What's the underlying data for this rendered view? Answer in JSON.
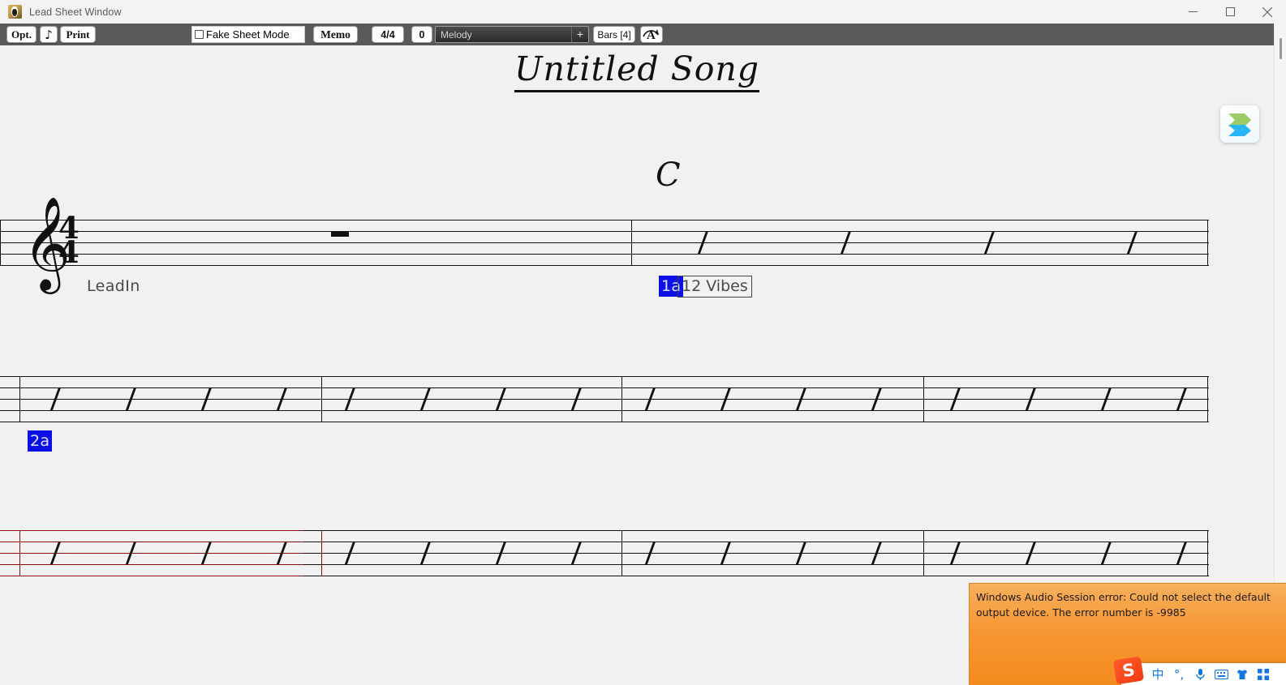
{
  "window": {
    "title": "Lead Sheet Window",
    "icon": "penguin-app-icon",
    "controls": {
      "minimize": "minimize-icon",
      "maximize": "maximize-icon",
      "close": "close-icon"
    }
  },
  "toolbar": {
    "opt_label": "Opt.",
    "note_label": "♪",
    "print_label": "Print",
    "fake_sheet_mode_label": "Fake Sheet Mode",
    "fake_sheet_mode_checked": false,
    "memo_label": "Memo",
    "meter_label": "4/4",
    "transpose_label": "0",
    "track_value": "Melody",
    "track_add_label": "+",
    "bars_label": "Bars [4]",
    "ai_label": "A",
    "background_color": "#5a5a5a"
  },
  "score": {
    "song_title": "Untitled Song",
    "chord_symbol": "C",
    "leadin_label": "LeadIn",
    "marker_1a": "1a",
    "section_name_1a": "12 Vibes",
    "marker_2a": "2a",
    "selection_color": "#8b0c0c",
    "marker_highlight_color": "#0b11e6",
    "systems": [
      {
        "index": 1,
        "measures": [
          {
            "slashes": 0,
            "rest": true,
            "selected": false
          },
          {
            "slashes": 4,
            "rest": false,
            "selected": false
          }
        ]
      },
      {
        "index": 2,
        "measures": [
          {
            "slashes": 4,
            "rest": false,
            "selected": false
          },
          {
            "slashes": 4,
            "rest": false,
            "selected": false
          },
          {
            "slashes": 4,
            "rest": false,
            "selected": false
          },
          {
            "slashes": 4,
            "rest": false,
            "selected": false
          }
        ]
      },
      {
        "index": 3,
        "measures": [
          {
            "slashes": 4,
            "rest": false,
            "selected": true
          },
          {
            "slashes": 4,
            "rest": false,
            "selected": false
          },
          {
            "slashes": 4,
            "rest": false,
            "selected": false
          },
          {
            "slashes": 4,
            "rest": false,
            "selected": false
          }
        ]
      }
    ]
  },
  "floating_widget": {
    "icon": "snipaste-chevron-icon"
  },
  "toast": {
    "message": "Windows Audio Session error: Could not select the default output device. The error number is -9985",
    "background_color": "#f79835"
  },
  "ime": {
    "logo": "S",
    "items": [
      {
        "icon": "chinese-mode-icon",
        "label": "中"
      },
      {
        "icon": "punctuation-icon",
        "label": "°,"
      },
      {
        "icon": "microphone-icon",
        "label": "mic"
      },
      {
        "icon": "keyboard-icon",
        "label": "kbd"
      },
      {
        "icon": "skin-icon",
        "label": "skin"
      },
      {
        "icon": "toolbox-icon",
        "label": "apps"
      }
    ]
  }
}
